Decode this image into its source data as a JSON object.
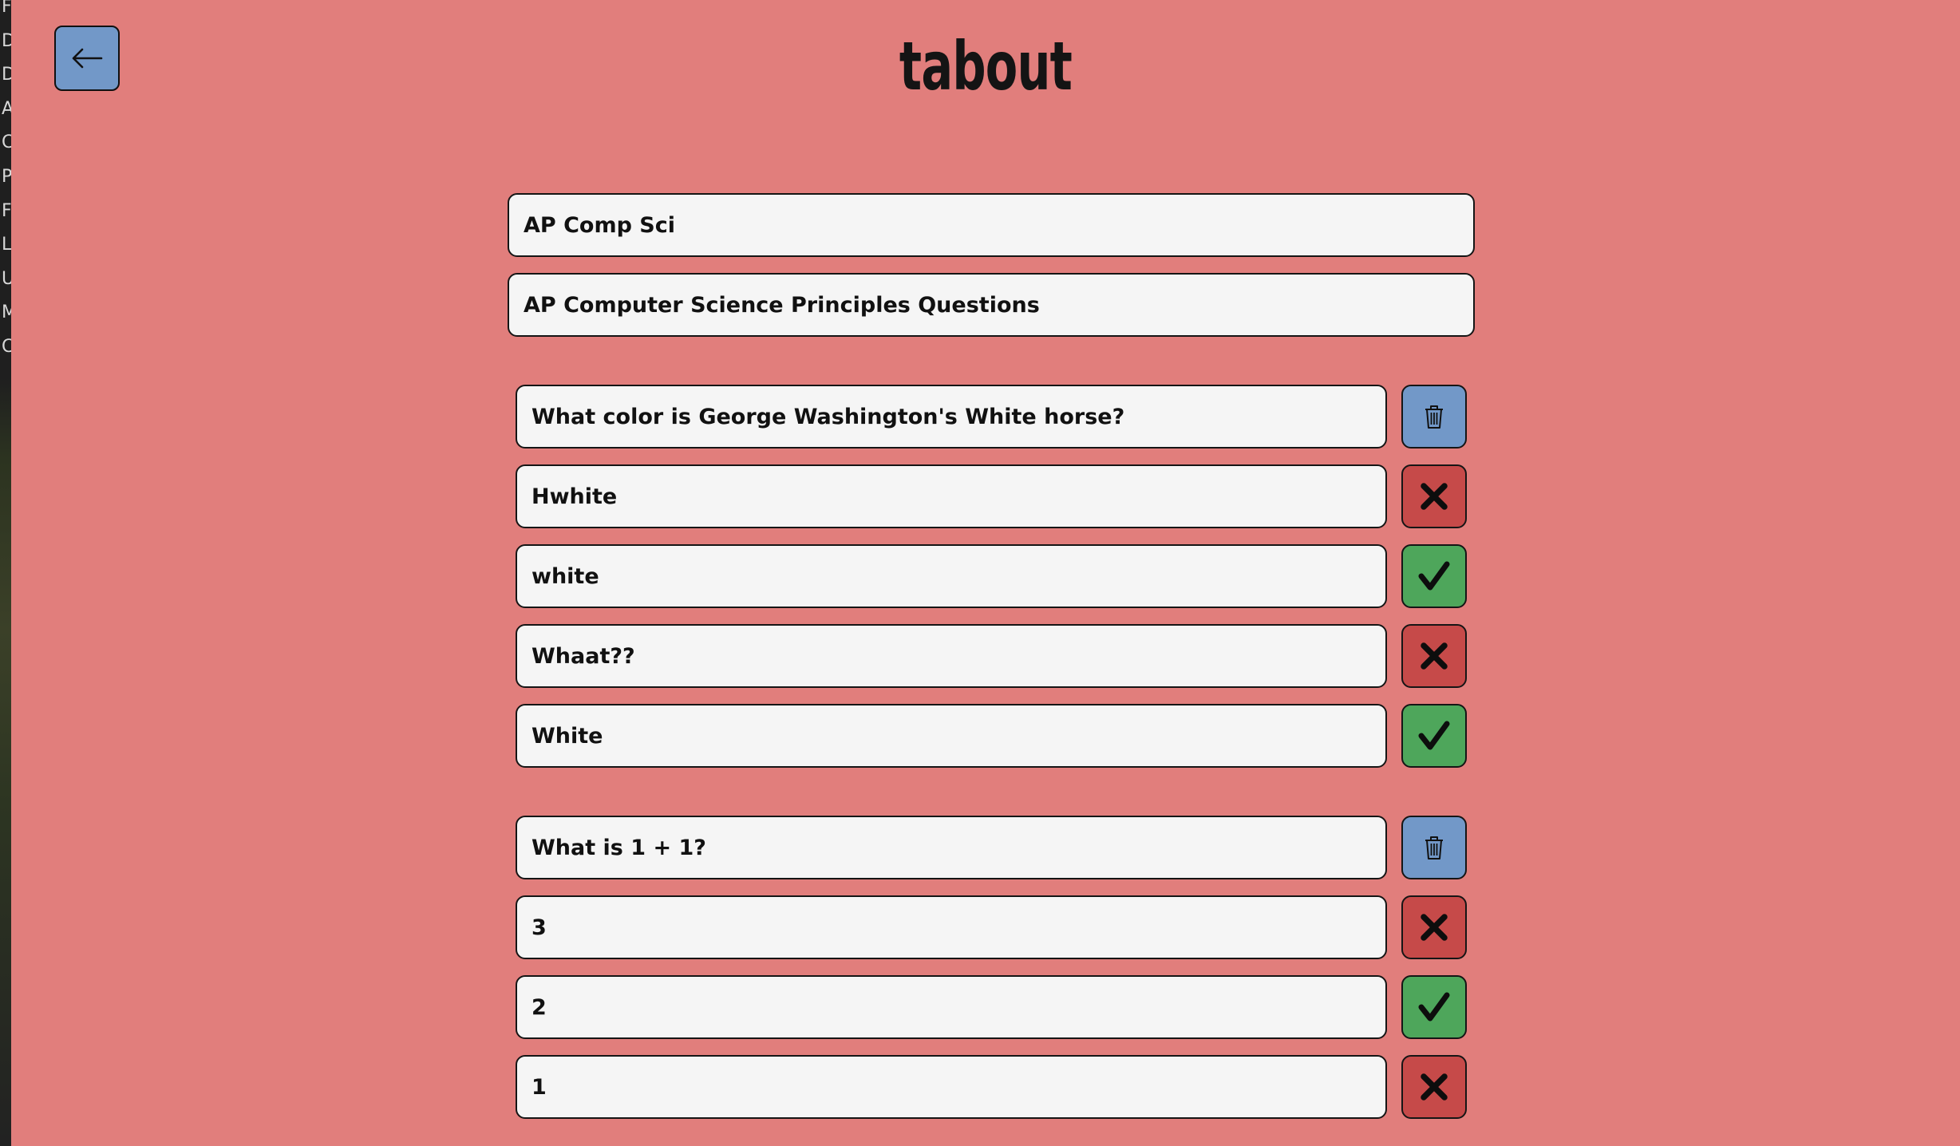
{
  "app": {
    "title": "tabout"
  },
  "edge_letters": [
    "F",
    "D",
    "D",
    "A",
    "C",
    "P",
    "F",
    "L",
    "U",
    "M",
    "C"
  ],
  "nav": {
    "back_icon": "arrow-left-icon"
  },
  "set": {
    "course": "AP Comp Sci",
    "title": "AP Computer Science Principles Questions"
  },
  "colors": {
    "background": "#e17e7c",
    "delete_button": "#7298c8",
    "wrong_button": "#c64a49",
    "correct_button": "#4ea65b",
    "field": "#f5f5f5"
  },
  "questions": [
    {
      "text": "What color is George Washington's White horse?",
      "answers": [
        {
          "text": "Hwhite",
          "correct": false
        },
        {
          "text": "white",
          "correct": true
        },
        {
          "text": "Whaat??",
          "correct": false
        },
        {
          "text": "White",
          "correct": true
        }
      ]
    },
    {
      "text": "What is 1 + 1?",
      "answers": [
        {
          "text": "3",
          "correct": false
        },
        {
          "text": "2",
          "correct": true
        },
        {
          "text": "1",
          "correct": false
        }
      ]
    }
  ]
}
